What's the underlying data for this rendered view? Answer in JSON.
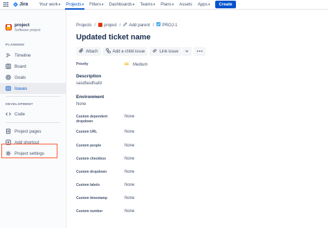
{
  "topnav": {
    "logo_text": "Jira",
    "items": [
      {
        "label": "Your work",
        "active": false
      },
      {
        "label": "Projects",
        "active": true
      },
      {
        "label": "Filters",
        "active": false
      },
      {
        "label": "Dashboards",
        "active": false
      },
      {
        "label": "Teams",
        "active": false
      },
      {
        "label": "Plans",
        "active": false
      },
      {
        "label": "Assets",
        "active": false
      },
      {
        "label": "Apps",
        "active": false
      }
    ],
    "create_label": "Create"
  },
  "sidebar": {
    "project_name": "project",
    "project_type": "Software project",
    "planning_label": "PLANNING",
    "planning_items": [
      {
        "label": "Timeline",
        "icon": "timeline-icon"
      },
      {
        "label": "Board",
        "icon": "board-icon"
      },
      {
        "label": "Goals",
        "icon": "goals-icon"
      },
      {
        "label": "Issues",
        "icon": "issues-icon",
        "selected": true
      }
    ],
    "development_label": "DEVELOPMENT",
    "development_items": [
      {
        "label": "Code",
        "icon": "code-icon"
      }
    ],
    "bottom_items": [
      {
        "label": "Project pages",
        "icon": "pages-icon"
      },
      {
        "label": "Add shortcut",
        "icon": "shortcut-icon"
      },
      {
        "label": "Project settings",
        "icon": "gear-icon"
      }
    ]
  },
  "breadcrumb": {
    "projects": "Projects",
    "project": "project",
    "add_parent": "Add parent",
    "issue_key": "PROJ-1"
  },
  "issue": {
    "title": "Updated ticket name",
    "actions": {
      "attach": "Attach",
      "add_child": "Add a child issue",
      "link_issue": "Link issue"
    },
    "priority_label": "Priority",
    "priority_value": "Medium",
    "description_label": "Description",
    "description_value": "sasdfasdfsafd",
    "environment_label": "Environment",
    "environment_value": "None",
    "custom_fields": [
      {
        "label": "Custom dependent dropdown",
        "value": "None"
      },
      {
        "label": "Custom URL",
        "value": "None"
      },
      {
        "label": "Custom people",
        "value": "None"
      },
      {
        "label": "Custom checkbox",
        "value": "None"
      },
      {
        "label": "Custom dropdown",
        "value": "None"
      },
      {
        "label": "Custom labels",
        "value": "None"
      },
      {
        "label": "Custom timestamp",
        "value": "None"
      },
      {
        "label": "Custom number",
        "value": "None"
      }
    ]
  },
  "colors": {
    "accent": "#0052cc",
    "highlight": "#ff5630",
    "priority": "#ffab00"
  }
}
